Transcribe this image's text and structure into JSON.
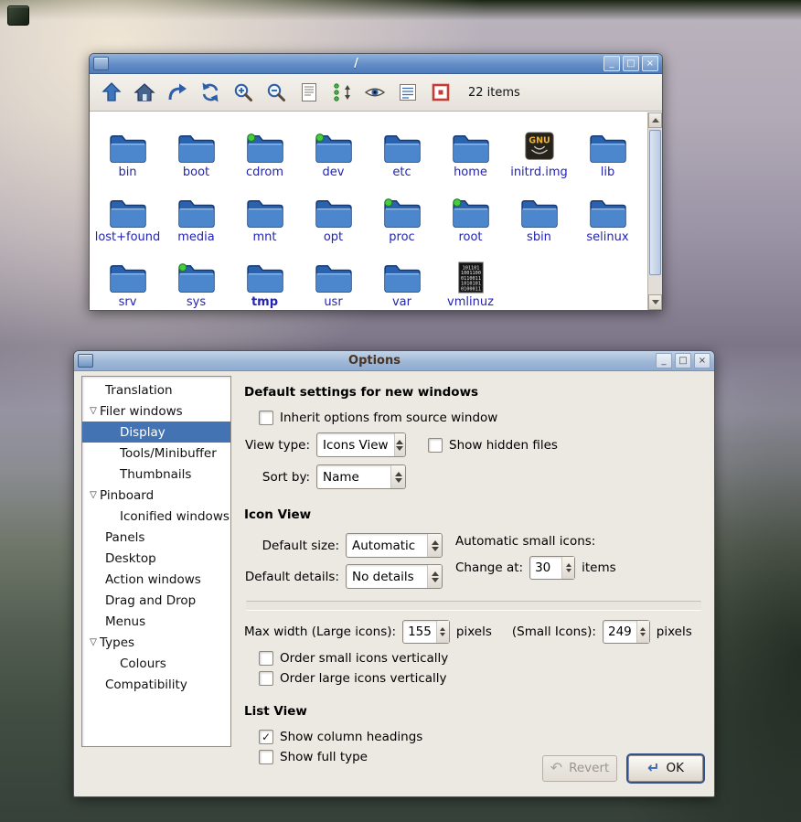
{
  "colors": {
    "titlebar_active": "#5e89c4",
    "titlebar_soft": "#9cb6d6",
    "selection": "#4473b4",
    "file_label": "#2323b6",
    "folder_blue": "#2b62ad",
    "mounted_dot": "#44cc44",
    "window_bg": "#ece8e2"
  },
  "filer": {
    "title": "/",
    "status": "22 items",
    "window_controls": {
      "minimize": "_",
      "maximize": "□",
      "close": "×"
    },
    "toolbar": [
      {
        "name": "up-icon"
      },
      {
        "name": "home-icon"
      },
      {
        "name": "redo-icon"
      },
      {
        "name": "refresh-icon"
      },
      {
        "name": "zoom-in-icon"
      },
      {
        "name": "zoom-icon"
      },
      {
        "name": "details-icon"
      },
      {
        "name": "sort-icon"
      },
      {
        "name": "show-hidden-icon"
      },
      {
        "name": "list-view-icon"
      },
      {
        "name": "select-all-icon"
      }
    ],
    "files": [
      {
        "label": "bin",
        "icon": "folder"
      },
      {
        "label": "boot",
        "icon": "folder"
      },
      {
        "label": "cdrom",
        "icon": "folder-mounted"
      },
      {
        "label": "dev",
        "icon": "folder-mounted"
      },
      {
        "label": "etc",
        "icon": "folder"
      },
      {
        "label": "home",
        "icon": "folder"
      },
      {
        "label": "initrd.img",
        "icon": "gnu-image"
      },
      {
        "label": "lib",
        "icon": "folder"
      },
      {
        "label": "lost+found",
        "icon": "folder"
      },
      {
        "label": "media",
        "icon": "folder"
      },
      {
        "label": "mnt",
        "icon": "folder"
      },
      {
        "label": "opt",
        "icon": "folder"
      },
      {
        "label": "proc",
        "icon": "folder-mounted"
      },
      {
        "label": "root",
        "icon": "folder-mounted"
      },
      {
        "label": "sbin",
        "icon": "folder"
      },
      {
        "label": "selinux",
        "icon": "folder"
      },
      {
        "label": "srv",
        "icon": "folder"
      },
      {
        "label": "sys",
        "icon": "folder-mounted"
      },
      {
        "label": "tmp",
        "icon": "folder",
        "bold": true
      },
      {
        "label": "usr",
        "icon": "folder"
      },
      {
        "label": "var",
        "icon": "folder"
      },
      {
        "label": "vmlinuz",
        "icon": "binary"
      }
    ]
  },
  "options": {
    "title": "Options",
    "window_controls": {
      "minimize": "_",
      "maximize": "□",
      "close": "×"
    },
    "sidebar": [
      {
        "label": "Translation",
        "level": 1
      },
      {
        "label": "Filer windows",
        "level": 0,
        "expander": true
      },
      {
        "label": "Display",
        "level": 2,
        "selected": true
      },
      {
        "label": "Tools/Minibuffer",
        "level": 2
      },
      {
        "label": "Thumbnails",
        "level": 2
      },
      {
        "label": "Pinboard",
        "level": 0,
        "expander": true
      },
      {
        "label": "Iconified windows",
        "level": 2
      },
      {
        "label": "Panels",
        "level": 1
      },
      {
        "label": "Desktop",
        "level": 1
      },
      {
        "label": "Action windows",
        "level": 1
      },
      {
        "label": "Drag and Drop",
        "level": 1
      },
      {
        "label": "Menus",
        "level": 1
      },
      {
        "label": "Types",
        "level": 0,
        "expander": true
      },
      {
        "label": "Colours",
        "level": 2
      },
      {
        "label": "Compatibility",
        "level": 1
      }
    ],
    "sections": {
      "defaults_header": "Default settings for new windows",
      "inherit_label": "Inherit options from source window",
      "view_type_label": "View type:",
      "view_type_value": "Icons View",
      "show_hidden_label": "Show hidden files",
      "sort_by_label": "Sort by:",
      "sort_by_value": "Name",
      "icon_view_header": "Icon View",
      "default_size_label": "Default size:",
      "default_size_value": "Automatic",
      "auto_small_label": "Automatic small icons:",
      "change_at_label": "Change at:",
      "change_at_value": "30",
      "items_suffix": "items",
      "default_details_label": "Default details:",
      "default_details_value": "No details",
      "max_width_label": "Max width (Large icons):",
      "max_width_value": "155",
      "pixels_suffix": "pixels",
      "small_icons_label": "(Small Icons):",
      "small_icons_value": "249",
      "pixels_suffix2": "pixels",
      "order_small_label": "Order small icons vertically",
      "order_large_label": "Order large icons vertically",
      "list_view_header": "List View",
      "show_headings_label": "Show column headings",
      "show_full_type_label": "Show full type"
    },
    "checkboxes": {
      "inherit": false,
      "show_hidden": false,
      "order_small": false,
      "order_large": false,
      "show_headings": true,
      "show_full_type": false
    },
    "buttons": {
      "revert": "Revert",
      "ok": "OK"
    }
  }
}
